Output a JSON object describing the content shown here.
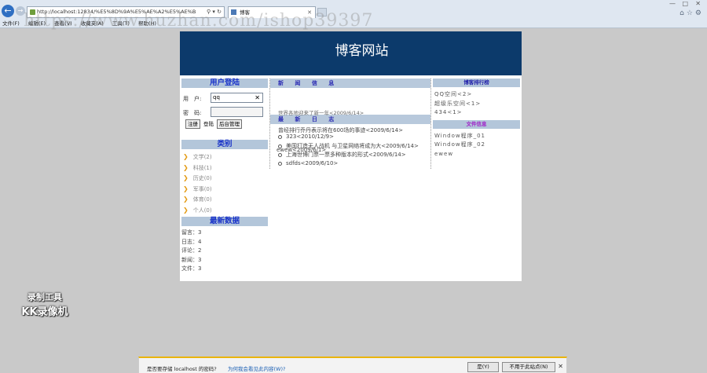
{
  "browser": {
    "url": "http://localhost:12834/%E5%8D%9A%E5%AE%A2%E5%AE%B",
    "tab_title": "博客",
    "menu": [
      "文件(F)",
      "编辑(E)",
      "查看(V)",
      "收藏夹(A)",
      "工具(T)",
      "帮助(H)"
    ],
    "watermark": "https://www.huzhan.com/ishop39397"
  },
  "site": {
    "title": "博客网站"
  },
  "login": {
    "heading": "用户登陆",
    "user_label": "用　户:",
    "user_value": "qq",
    "password_label": "密　码:",
    "register_btn": "注册",
    "login_btn": "登陆",
    "admin_btn": "后台管理"
  },
  "categories": {
    "heading": "类别",
    "items": [
      "文学(2)",
      "科技(1)",
      "历史(0)",
      "军事(0)",
      "体育(0)",
      "个人(0)"
    ]
  },
  "stats": {
    "heading": "最新数据",
    "items": [
      "留言：3",
      "日志：4",
      "评论：2",
      "新闻：3",
      "文件：3"
    ]
  },
  "news": {
    "heading": "新 闻 信 息",
    "overlap_line": "世界各地迎来了新一年<2009/6/14>"
  },
  "logs": {
    "heading": "最 新 日 志",
    "items": [
      "曾经排行乔丹表示将在600场的事迹<2009/6/14>",
      "323<2010/12/9>",
      "美国打造无人战机 与卫星网络将成为大<2009/6/14>",
      "ewew<2009/6/1>",
      "上海世博门票一票多种版本的形式<2009/6/14>",
      "sdfds<2009/6/10>"
    ]
  },
  "ranking": {
    "heading": "博客排行榜",
    "items": [
      "QQ空间<2>",
      "超级乐空间<1>",
      "434<1>"
    ]
  },
  "files": {
    "heading": "文件信息",
    "items": [
      "Window程序_01",
      "Window程序_02",
      "ewew"
    ]
  },
  "recorder": {
    "line1": "录制工具",
    "line2": "KK录像机"
  },
  "notification": {
    "text": "是否要存储 localhost 的密码?",
    "link": "为何我会看见此内容(W)?",
    "yes_btn": "是(Y)",
    "no_btn": "不用于此站点(N)"
  },
  "colors": {
    "banner": "#0c3a6b",
    "section_bar": "#b3c6da",
    "left_heading": "#1a34c9",
    "category_arrow": "#e39a12"
  }
}
